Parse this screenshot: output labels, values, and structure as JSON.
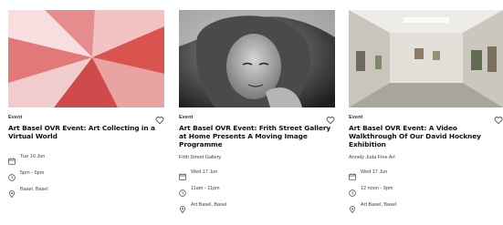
{
  "cards": [
    {
      "tag": "Event",
      "title": "Art Basel OVR Event: Art Collecting in a Virtual World",
      "gallery": "",
      "date": "Tue 16 Jun",
      "time": "5pm - 6pm",
      "location": "Basel, Basel",
      "image": "red-geometric-pinwheel-artwork"
    },
    {
      "tag": "Event",
      "title": "Art Basel OVR Event: Frith Street Gallery at Home Presents A Moving Image Programme",
      "gallery": "Frith Street Gallery",
      "date": "Wed 17 Jun",
      "time": "11am - 11pm",
      "location": "Art Basel, Basel",
      "image": "black-and-white-portrait-photo"
    },
    {
      "tag": "Event",
      "title": "Art Basel OVR Event: A Video Walkthrough Of Our David Hockney Exhibition",
      "gallery": "Annely Juda Fine Art",
      "date": "Wed 17 Jun",
      "time": "12 noon - 9pm",
      "location": "Art Basel, Basel",
      "image": "gallery-interior-photo"
    }
  ],
  "icons": {
    "favorite": "heart-outline-icon",
    "date": "calendar-icon",
    "time": "clock-icon",
    "location": "location-pin-icon"
  },
  "colors": {
    "text": "#111111",
    "secondary": "#444444",
    "accent_red": "#d9534f"
  }
}
